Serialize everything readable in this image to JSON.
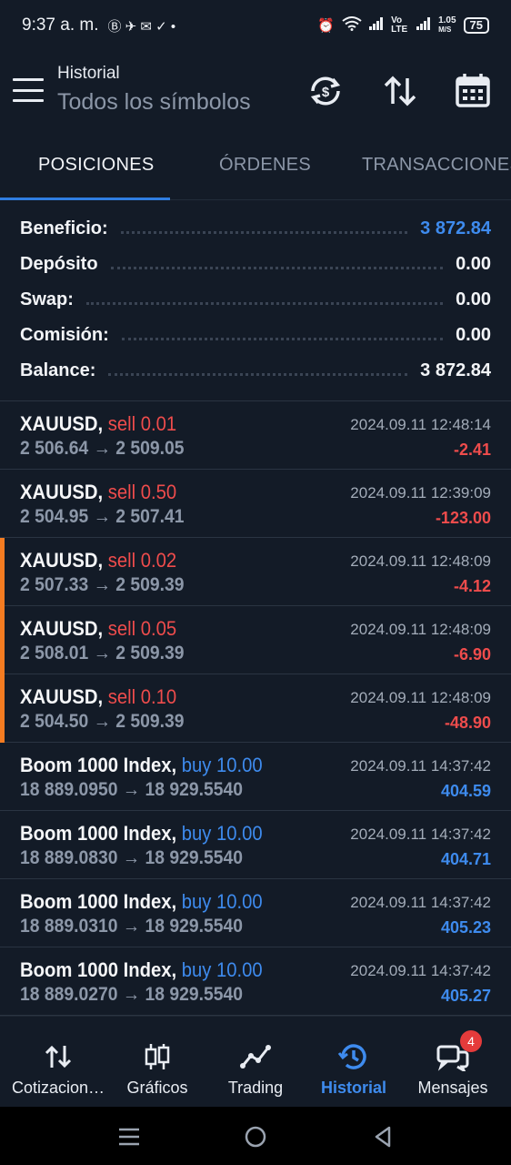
{
  "status_bar": {
    "time": "9:37 a. m.",
    "net_speed_top": "1.05",
    "net_speed_bottom": "M/S",
    "volte": "Vo LTE",
    "battery": "75"
  },
  "header": {
    "subtitle": "Historial",
    "title": "Todos los símbolos"
  },
  "tabs": [
    {
      "label": "POSICIONES",
      "active": true
    },
    {
      "label": "ÓRDENES",
      "active": false
    },
    {
      "label": "TRANSACCIONES",
      "active": false
    }
  ],
  "summary": [
    {
      "label": "Beneficio:",
      "value": "3 872.84",
      "highlight": true
    },
    {
      "label": "Depósito",
      "value": "0.00",
      "highlight": false
    },
    {
      "label": "Swap:",
      "value": "0.00",
      "highlight": false
    },
    {
      "label": "Comisión:",
      "value": "0.00",
      "highlight": false
    },
    {
      "label": "Balance:",
      "value": "3 872.84",
      "highlight": false
    }
  ],
  "deals": [
    {
      "symbol": "XAUUSD,",
      "side": "sell 0.01",
      "side_type": "sell",
      "prices": "2 506.64 → 2 509.05",
      "time": "2024.09.11 12:48:14",
      "profit": "-2.41",
      "marked": false
    },
    {
      "symbol": "XAUUSD,",
      "side": "sell 0.50",
      "side_type": "sell",
      "prices": "2 504.95 → 2 507.41",
      "time": "2024.09.11 12:39:09",
      "profit": "-123.00",
      "marked": false
    },
    {
      "symbol": "XAUUSD,",
      "side": "sell 0.02",
      "side_type": "sell",
      "prices": "2 507.33 → 2 509.39",
      "time": "2024.09.11 12:48:09",
      "profit": "-4.12",
      "marked": true
    },
    {
      "symbol": "XAUUSD,",
      "side": "sell 0.05",
      "side_type": "sell",
      "prices": "2 508.01 → 2 509.39",
      "time": "2024.09.11 12:48:09",
      "profit": "-6.90",
      "marked": true
    },
    {
      "symbol": "XAUUSD,",
      "side": "sell 0.10",
      "side_type": "sell",
      "prices": "2 504.50 → 2 509.39",
      "time": "2024.09.11 12:48:09",
      "profit": "-48.90",
      "marked": true
    },
    {
      "symbol": "Boom 1000 Index,",
      "side": "buy 10.00",
      "side_type": "buy",
      "prices": "18 889.0950 → 18 929.5540",
      "time": "2024.09.11 14:37:42",
      "profit": "404.59",
      "marked": false
    },
    {
      "symbol": "Boom 1000 Index,",
      "side": "buy 10.00",
      "side_type": "buy",
      "prices": "18 889.0830 → 18 929.5540",
      "time": "2024.09.11 14:37:42",
      "profit": "404.71",
      "marked": false
    },
    {
      "symbol": "Boom 1000 Index,",
      "side": "buy 10.00",
      "side_type": "buy",
      "prices": "18 889.0310 → 18 929.5540",
      "time": "2024.09.11 14:37:42",
      "profit": "405.23",
      "marked": false
    },
    {
      "symbol": "Boom 1000 Index,",
      "side": "buy 10.00",
      "side_type": "buy",
      "prices": "18 889.0270 → 18 929.5540",
      "time": "2024.09.11 14:37:42",
      "profit": "405.27",
      "marked": false
    }
  ],
  "bottom_nav": [
    {
      "label": "Cotizacion…",
      "icon": "quotes-arrows-icon",
      "active": false
    },
    {
      "label": "Gráficos",
      "icon": "candlestick-icon",
      "active": false
    },
    {
      "label": "Trading",
      "icon": "trading-line-icon",
      "active": false
    },
    {
      "label": "Historial",
      "icon": "history-clock-icon",
      "active": true
    },
    {
      "label": "Mensajes",
      "icon": "chat-bubbles-icon",
      "active": false,
      "badge": "4"
    }
  ],
  "colors": {
    "background": "#131b27",
    "accent_blue": "#3e8bee",
    "sell_red": "#ef4c4c",
    "marker_orange": "#f57c21"
  }
}
